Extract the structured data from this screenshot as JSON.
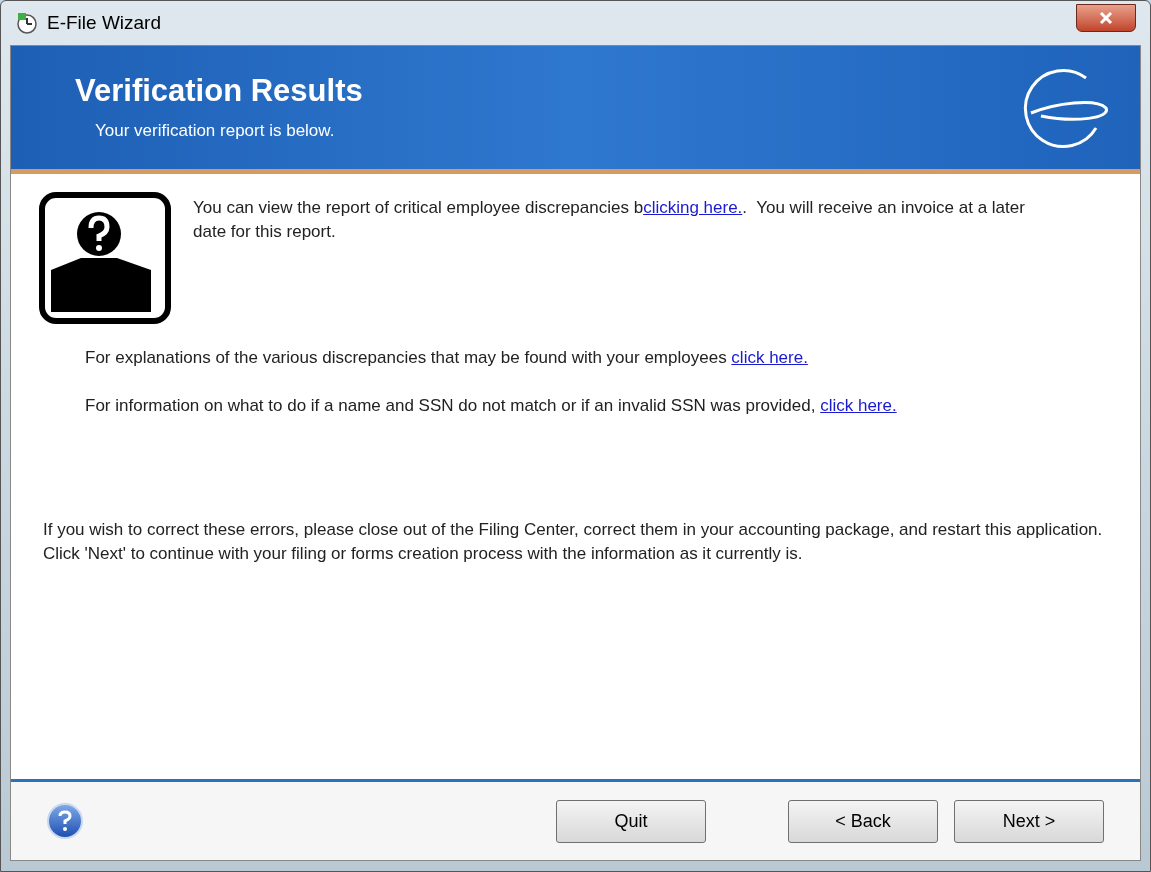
{
  "window": {
    "title": "E-File Wizard"
  },
  "header": {
    "title": "Verification Results",
    "subtitle": "Your verification report is below."
  },
  "paragraphs": [
    {
      "segments": [
        {
          "kind": "text",
          "text": "You can view the report of critical employee discrepancies b"
        },
        {
          "kind": "link",
          "text": "clicking here."
        },
        {
          "kind": "text",
          "text": ".  You will receive an invoice at a later date for this report."
        }
      ]
    },
    {
      "segments": [
        {
          "kind": "text",
          "text": "For explanations of the various discrepancies that may be found with your employees "
        },
        {
          "kind": "link",
          "text": "click here."
        }
      ]
    },
    {
      "segments": [
        {
          "kind": "text",
          "text": "For information on what to do if a name and SSN do not match or if an invalid SSN was provided, "
        },
        {
          "kind": "link",
          "text": "click here."
        }
      ]
    },
    {
      "segments": [
        {
          "kind": "text",
          "text": "If you wish to correct these errors, please close out of the Filing Center, correct them in your accounting package, and restart this application.  Click 'Next' to continue with your filing or forms creation process with the information as it currently is."
        }
      ]
    }
  ],
  "buttons": [
    {
      "label": "Quit",
      "kind": "quit"
    },
    {
      "label": "< Back",
      "kind": "back"
    },
    {
      "label": "Next >",
      "kind": "next"
    }
  ]
}
